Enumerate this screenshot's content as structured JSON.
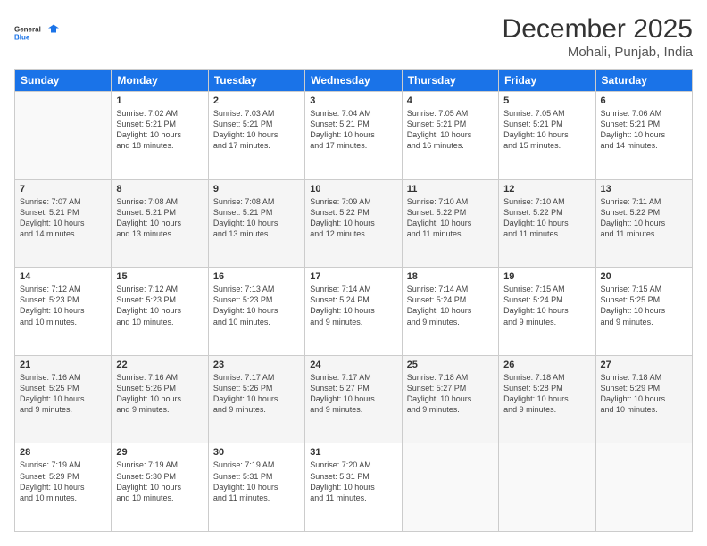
{
  "logo": {
    "line1": "General",
    "line2": "Blue"
  },
  "title": "December 2025",
  "subtitle": "Mohali, Punjab, India",
  "weekdays": [
    "Sunday",
    "Monday",
    "Tuesday",
    "Wednesday",
    "Thursday",
    "Friday",
    "Saturday"
  ],
  "weeks": [
    [
      {
        "day": "",
        "info": ""
      },
      {
        "day": "1",
        "info": "Sunrise: 7:02 AM\nSunset: 5:21 PM\nDaylight: 10 hours\nand 18 minutes."
      },
      {
        "day": "2",
        "info": "Sunrise: 7:03 AM\nSunset: 5:21 PM\nDaylight: 10 hours\nand 17 minutes."
      },
      {
        "day": "3",
        "info": "Sunrise: 7:04 AM\nSunset: 5:21 PM\nDaylight: 10 hours\nand 17 minutes."
      },
      {
        "day": "4",
        "info": "Sunrise: 7:05 AM\nSunset: 5:21 PM\nDaylight: 10 hours\nand 16 minutes."
      },
      {
        "day": "5",
        "info": "Sunrise: 7:05 AM\nSunset: 5:21 PM\nDaylight: 10 hours\nand 15 minutes."
      },
      {
        "day": "6",
        "info": "Sunrise: 7:06 AM\nSunset: 5:21 PM\nDaylight: 10 hours\nand 14 minutes."
      }
    ],
    [
      {
        "day": "7",
        "info": "Sunrise: 7:07 AM\nSunset: 5:21 PM\nDaylight: 10 hours\nand 14 minutes."
      },
      {
        "day": "8",
        "info": "Sunrise: 7:08 AM\nSunset: 5:21 PM\nDaylight: 10 hours\nand 13 minutes."
      },
      {
        "day": "9",
        "info": "Sunrise: 7:08 AM\nSunset: 5:21 PM\nDaylight: 10 hours\nand 13 minutes."
      },
      {
        "day": "10",
        "info": "Sunrise: 7:09 AM\nSunset: 5:22 PM\nDaylight: 10 hours\nand 12 minutes."
      },
      {
        "day": "11",
        "info": "Sunrise: 7:10 AM\nSunset: 5:22 PM\nDaylight: 10 hours\nand 11 minutes."
      },
      {
        "day": "12",
        "info": "Sunrise: 7:10 AM\nSunset: 5:22 PM\nDaylight: 10 hours\nand 11 minutes."
      },
      {
        "day": "13",
        "info": "Sunrise: 7:11 AM\nSunset: 5:22 PM\nDaylight: 10 hours\nand 11 minutes."
      }
    ],
    [
      {
        "day": "14",
        "info": "Sunrise: 7:12 AM\nSunset: 5:23 PM\nDaylight: 10 hours\nand 10 minutes."
      },
      {
        "day": "15",
        "info": "Sunrise: 7:12 AM\nSunset: 5:23 PM\nDaylight: 10 hours\nand 10 minutes."
      },
      {
        "day": "16",
        "info": "Sunrise: 7:13 AM\nSunset: 5:23 PM\nDaylight: 10 hours\nand 10 minutes."
      },
      {
        "day": "17",
        "info": "Sunrise: 7:14 AM\nSunset: 5:24 PM\nDaylight: 10 hours\nand 9 minutes."
      },
      {
        "day": "18",
        "info": "Sunrise: 7:14 AM\nSunset: 5:24 PM\nDaylight: 10 hours\nand 9 minutes."
      },
      {
        "day": "19",
        "info": "Sunrise: 7:15 AM\nSunset: 5:24 PM\nDaylight: 10 hours\nand 9 minutes."
      },
      {
        "day": "20",
        "info": "Sunrise: 7:15 AM\nSunset: 5:25 PM\nDaylight: 10 hours\nand 9 minutes."
      }
    ],
    [
      {
        "day": "21",
        "info": "Sunrise: 7:16 AM\nSunset: 5:25 PM\nDaylight: 10 hours\nand 9 minutes."
      },
      {
        "day": "22",
        "info": "Sunrise: 7:16 AM\nSunset: 5:26 PM\nDaylight: 10 hours\nand 9 minutes."
      },
      {
        "day": "23",
        "info": "Sunrise: 7:17 AM\nSunset: 5:26 PM\nDaylight: 10 hours\nand 9 minutes."
      },
      {
        "day": "24",
        "info": "Sunrise: 7:17 AM\nSunset: 5:27 PM\nDaylight: 10 hours\nand 9 minutes."
      },
      {
        "day": "25",
        "info": "Sunrise: 7:18 AM\nSunset: 5:27 PM\nDaylight: 10 hours\nand 9 minutes."
      },
      {
        "day": "26",
        "info": "Sunrise: 7:18 AM\nSunset: 5:28 PM\nDaylight: 10 hours\nand 9 minutes."
      },
      {
        "day": "27",
        "info": "Sunrise: 7:18 AM\nSunset: 5:29 PM\nDaylight: 10 hours\nand 10 minutes."
      }
    ],
    [
      {
        "day": "28",
        "info": "Sunrise: 7:19 AM\nSunset: 5:29 PM\nDaylight: 10 hours\nand 10 minutes."
      },
      {
        "day": "29",
        "info": "Sunrise: 7:19 AM\nSunset: 5:30 PM\nDaylight: 10 hours\nand 10 minutes."
      },
      {
        "day": "30",
        "info": "Sunrise: 7:19 AM\nSunset: 5:31 PM\nDaylight: 10 hours\nand 11 minutes."
      },
      {
        "day": "31",
        "info": "Sunrise: 7:20 AM\nSunset: 5:31 PM\nDaylight: 10 hours\nand 11 minutes."
      },
      {
        "day": "",
        "info": ""
      },
      {
        "day": "",
        "info": ""
      },
      {
        "day": "",
        "info": ""
      }
    ]
  ]
}
